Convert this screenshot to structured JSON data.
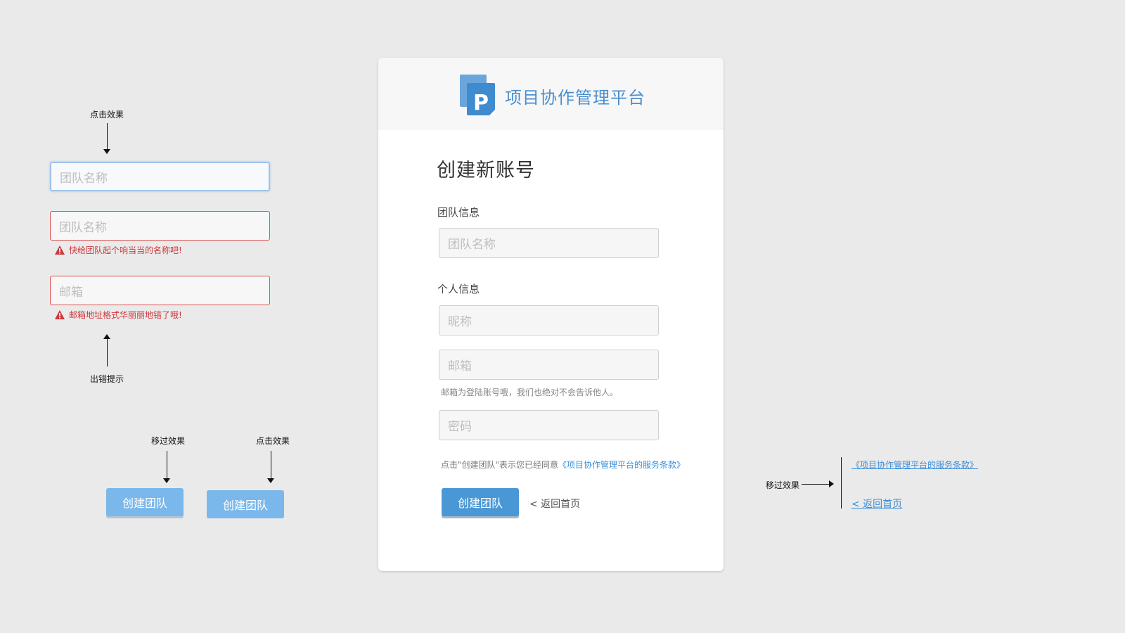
{
  "annotations": {
    "click_effect": "点击效果",
    "error_tip": "出错提示",
    "hover_effect": "移过效果",
    "click_effect_2": "点击效果",
    "hover_effect_right": "移过效果"
  },
  "samples": {
    "focus_placeholder": "团队名称",
    "error1_placeholder": "团队名称",
    "error1_message": "快给团队起个响当当的名称吧!",
    "error2_placeholder": "邮箱",
    "error2_message": "邮箱地址格式华丽丽地错了哦!",
    "hover_button": "创建团队",
    "press_button": "创建团队"
  },
  "card": {
    "brand": "项目协作管理平台",
    "title": "创建新账号",
    "team_section": "团队信息",
    "team_name_placeholder": "团队名称",
    "personal_section": "个人信息",
    "nickname_placeholder": "昵称",
    "email_placeholder": "邮箱",
    "email_hint": "邮箱为登陆账号哦，我们也绝对不会告诉他人。",
    "password_placeholder": "密码",
    "terms_prefix": "点击\"创建团队\"表示您已经同意",
    "terms_link": "《项目协作管理平台的服务条款》",
    "submit": "创建团队",
    "back": "< 返回首页"
  },
  "link_demo": {
    "terms_link": "《项目协作管理平台的服务条款》",
    "back_link": "< 返回首页"
  },
  "colors": {
    "brand": "#4a8fcf",
    "primary_button": "#4a97d6",
    "hover_button": "#7ab7ea",
    "error": "#d0363b",
    "link": "#3b8fd9"
  }
}
